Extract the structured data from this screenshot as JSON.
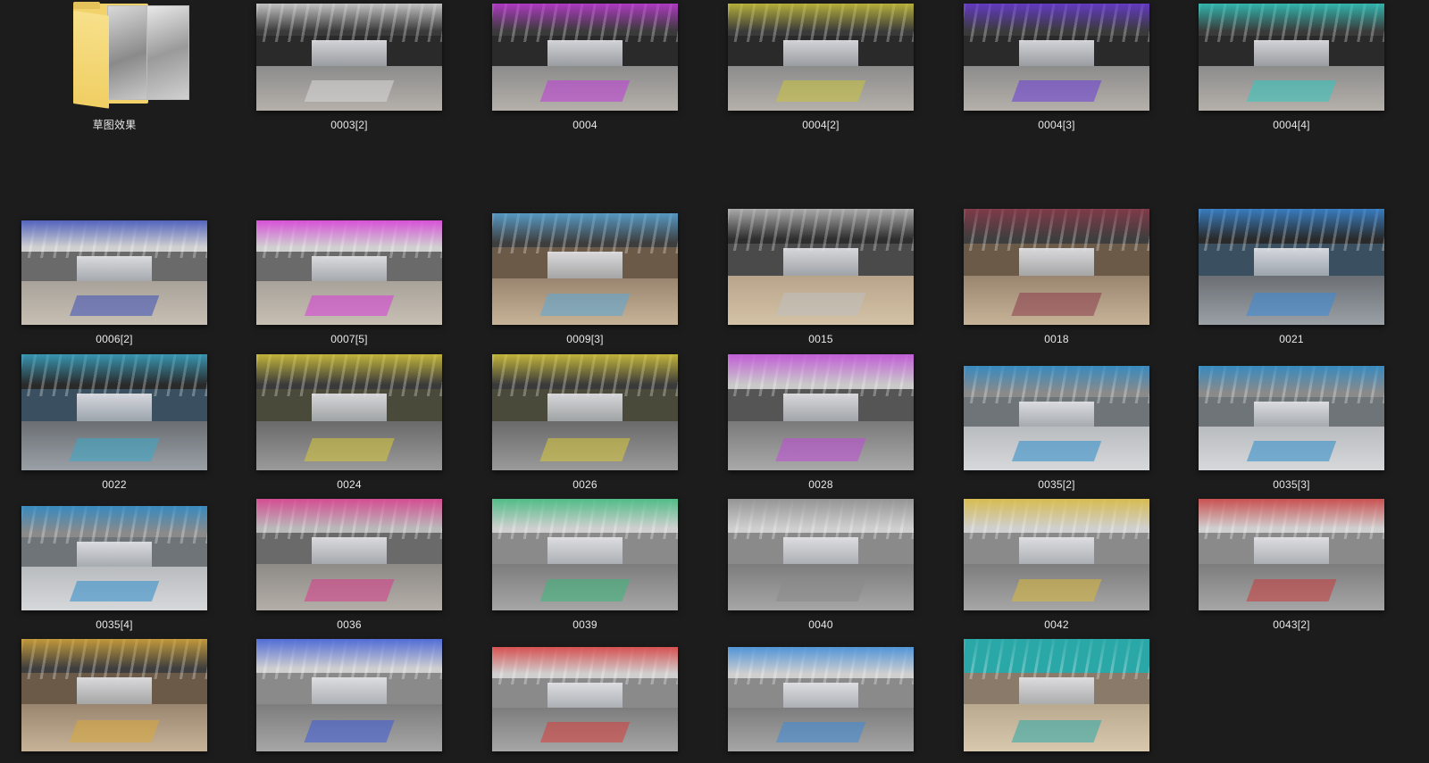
{
  "window": {
    "background": "#1c1c1c",
    "label_color": "#e8e8e8"
  },
  "folder": {
    "name": "草图效果",
    "icon": "folder-icon"
  },
  "files": [
    {
      "name": "0003[2]",
      "scene": "gym",
      "accent": "#d9d9d9"
    },
    {
      "name": "0004",
      "scene": "gym",
      "accent": "#c03ad8"
    },
    {
      "name": "0004[2]",
      "scene": "gym",
      "accent": "#c9c23a"
    },
    {
      "name": "0004[3]",
      "scene": "gym",
      "accent": "#6a3ad8"
    },
    {
      "name": "0004[4]",
      "scene": "gym",
      "accent": "#2fc9c0"
    },
    {
      "name": "0006[2]",
      "scene": "gym-floor",
      "accent": "#3b4fb8"
    },
    {
      "name": "0007[5]",
      "scene": "gym-floor",
      "accent": "#d83ad8"
    },
    {
      "name": "0009[3]",
      "scene": "lounge",
      "accent": "#5aa7d8"
    },
    {
      "name": "0015",
      "scene": "lobby",
      "accent": "#bfbfbf"
    },
    {
      "name": "0018",
      "scene": "lounge",
      "accent": "#8a3a4a"
    },
    {
      "name": "0021",
      "scene": "hall",
      "accent": "#3a8ad8"
    },
    {
      "name": "0022",
      "scene": "hall",
      "accent": "#3aa7c8"
    },
    {
      "name": "0024",
      "scene": "cafe",
      "accent": "#d8c83a"
    },
    {
      "name": "0026",
      "scene": "cafe",
      "accent": "#d8c83a"
    },
    {
      "name": "0028",
      "scene": "meeting",
      "accent": "#c04ad8"
    },
    {
      "name": "0035[2]",
      "scene": "entry",
      "accent": "#2a8ac8"
    },
    {
      "name": "0035[3]",
      "scene": "entry",
      "accent": "#2a8ac8"
    },
    {
      "name": "0035[4]",
      "scene": "entry",
      "accent": "#2a8ac8"
    },
    {
      "name": "0036",
      "scene": "stair",
      "accent": "#d83a8a"
    },
    {
      "name": "0039",
      "scene": "office",
      "accent": "#3ab87a"
    },
    {
      "name": "0040",
      "scene": "office",
      "accent": "#8a8a8a"
    },
    {
      "name": "0042",
      "scene": "office",
      "accent": "#d8b83a"
    },
    {
      "name": "0043[2]",
      "scene": "office",
      "accent": "#c83a3a"
    },
    {
      "name": "",
      "scene": "lounge",
      "accent": "#d8a83a"
    },
    {
      "name": "",
      "scene": "office",
      "accent": "#3a5ad8"
    },
    {
      "name": "",
      "scene": "office",
      "accent": "#d83a3a"
    },
    {
      "name": "",
      "scene": "office",
      "accent": "#3a8ad8"
    },
    {
      "name": "",
      "scene": "canteen",
      "accent": "#2aa8a8"
    }
  ]
}
